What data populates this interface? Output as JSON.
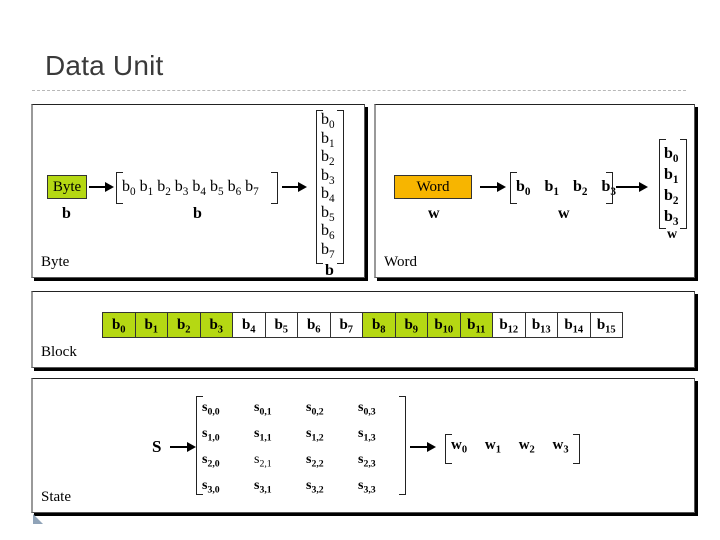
{
  "slide": {
    "title": "Data Unit"
  },
  "colors": {
    "byte_fill": "#b5d813",
    "word_fill": "#f7b500",
    "block_highlight": "#b5d813"
  },
  "byte_panel": {
    "label": "Byte",
    "box_label": "Byte",
    "symbol": "b",
    "row_bits": [
      "0",
      "1",
      "2",
      "3",
      "4",
      "5",
      "6",
      "7"
    ],
    "col_bits": [
      "0",
      "1",
      "2",
      "3",
      "4",
      "5",
      "6",
      "7"
    ],
    "row_symbol": "b",
    "col_symbol": "b"
  },
  "word_panel": {
    "label": "Word",
    "box_label": "Word",
    "symbol": "w",
    "row_bytes": [
      "0",
      "1",
      "2",
      "3"
    ],
    "col_bytes": [
      "0",
      "1",
      "2",
      "3"
    ],
    "row_symbol": "w",
    "col_symbol": "w"
  },
  "block_panel": {
    "label": "Block",
    "cells": [
      {
        "idx": "0",
        "hl": true
      },
      {
        "idx": "1",
        "hl": true
      },
      {
        "idx": "2",
        "hl": true
      },
      {
        "idx": "3",
        "hl": true
      },
      {
        "idx": "4",
        "hl": false
      },
      {
        "idx": "5",
        "hl": false
      },
      {
        "idx": "6",
        "hl": false
      },
      {
        "idx": "7",
        "hl": false
      },
      {
        "idx": "8",
        "hl": true
      },
      {
        "idx": "9",
        "hl": true
      },
      {
        "idx": "10",
        "hl": true
      },
      {
        "idx": "11",
        "hl": true
      },
      {
        "idx": "12",
        "hl": false
      },
      {
        "idx": "13",
        "hl": false
      },
      {
        "idx": "14",
        "hl": false
      },
      {
        "idx": "15",
        "hl": false
      }
    ]
  },
  "state_panel": {
    "label": "State",
    "symbol": "S",
    "matrix": [
      [
        "0,0",
        "0,1",
        "0,2",
        "0,3"
      ],
      [
        "1,0",
        "1,1",
        "1,2",
        "1,3"
      ],
      [
        "2,0",
        "2,1",
        "2,2",
        "2,3"
      ],
      [
        "3,0",
        "3,1",
        "3,2",
        "3,3"
      ]
    ],
    "plain_cells": [
      "2,1"
    ],
    "words": [
      "0",
      "1",
      "2",
      "3"
    ]
  }
}
